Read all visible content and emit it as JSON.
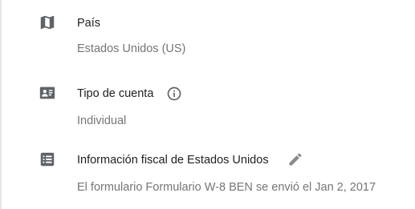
{
  "icons": {
    "country": "map-icon",
    "account_type": "contact-card-icon",
    "tax_info": "list-icon",
    "info": "info-icon",
    "edit": "pencil-icon"
  },
  "colors": {
    "label": "#212121",
    "value": "#757575",
    "icon": "#5f6368",
    "edit_icon": "#8a8a8a"
  },
  "fields": [
    {
      "label": "País",
      "value": "Estados Unidos (US)"
    },
    {
      "label": "Tipo de cuenta",
      "value": "Individual"
    },
    {
      "label": "Información fiscal de Estados Unidos",
      "value": "El formulario Formulario W-8 BEN se envió el Jan 2, 2017"
    }
  ]
}
